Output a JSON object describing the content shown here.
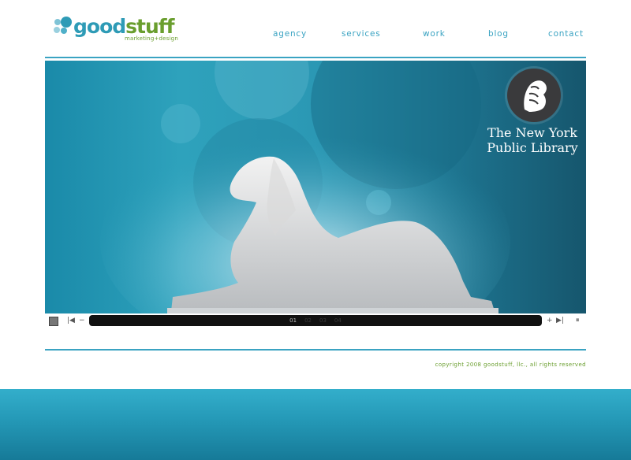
{
  "brand": {
    "name_part1": "good",
    "name_part2": "stuff",
    "tagline": "marketing+design",
    "colors": {
      "blue": "#3aa3c2",
      "green": "#6a9e2e"
    }
  },
  "nav": {
    "items": [
      "agency",
      "services",
      "work",
      "blog",
      "contact"
    ]
  },
  "banner": {
    "client_title_line1": "The New York",
    "client_title_line2": "Public Library",
    "badge_icon": "lion-icon",
    "image_subject": "lion-statue"
  },
  "slideshow": {
    "pages": [
      "01",
      "02",
      "03",
      "04"
    ],
    "current_page": "01"
  },
  "footer": {
    "copyright": "copyright 2008 goodstuff, llc., all rights reserved"
  }
}
